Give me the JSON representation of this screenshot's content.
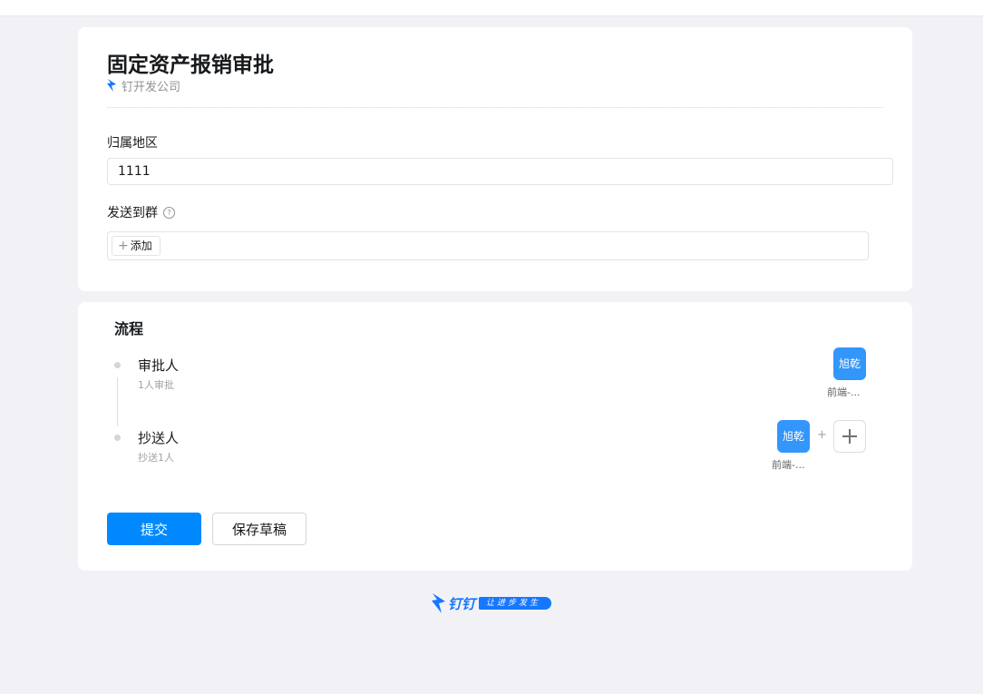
{
  "form": {
    "title": "固定资产报销审批",
    "org_name": "钉开发公司",
    "region_label": "归属地区",
    "region_value": "1111",
    "group_label": "发送到群",
    "help_icon_glyph": "?",
    "add_plus_glyph": "+",
    "add_label": "添加"
  },
  "flow": {
    "title": "流程",
    "approver": {
      "name": "审批人",
      "sub": "1人审批",
      "avatar_text": "旭乾",
      "person": "前端-..."
    },
    "cc": {
      "name": "抄送人",
      "sub": "抄送1人",
      "avatar_text": "旭乾",
      "person": "前端-...",
      "join_plus": "+"
    }
  },
  "buttons": {
    "submit": "提交",
    "save_draft": "保存草稿"
  },
  "footer": {
    "brand": "钉钉",
    "slogan": "让进步发生"
  },
  "colors": {
    "accent": "#0089ff",
    "avatar": "#3296fa",
    "brand": "#1677ff",
    "background": "#f2f2f6"
  },
  "icons": {
    "org": "dingtalk-logo-icon",
    "help": "question-circle-icon",
    "add": "plus-icon",
    "footer": "dingtalk-logo-icon"
  }
}
